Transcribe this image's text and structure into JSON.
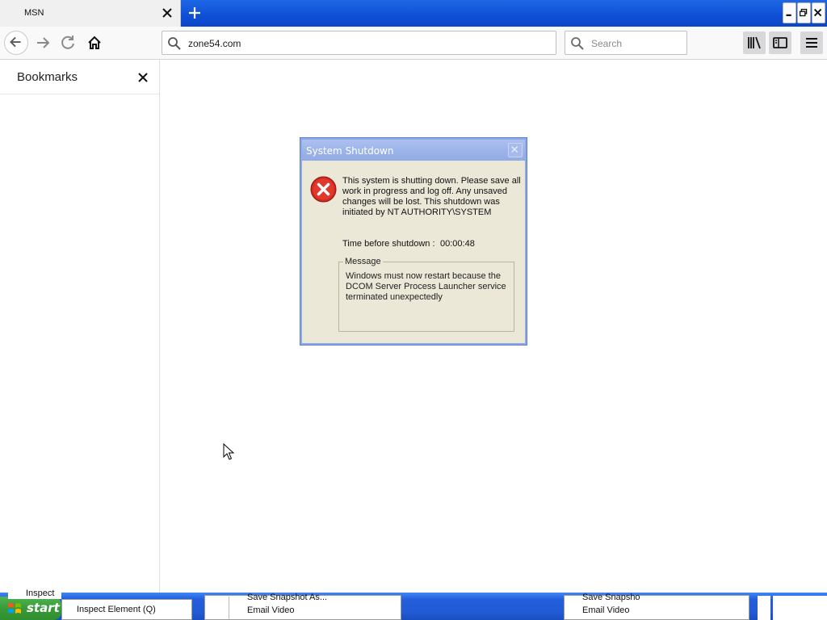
{
  "browser": {
    "tab_title": "MSN",
    "url": "zone54.com",
    "search_placeholder": "Search"
  },
  "sidebar": {
    "title": "Bookmarks"
  },
  "dialog": {
    "title": "System Shutdown",
    "message": "This system is shutting down. Please save all work in progress and log off. Any unsaved changes will be lost. This shutdown was initiated by NT AUTHORITY\\SYSTEM",
    "time_label": "Time before shutdown :",
    "time_value": "00:00:48",
    "group_label": "Message",
    "group_text": "Windows must now restart because the DCOM Server Process Launcher service terminated unexpectedly"
  },
  "taskbar": {
    "start_label": "start",
    "inspect_fragment": "Inspect",
    "inspect_menu_item": "Inspect Element (Q)",
    "save_snapshot_item": "Save Snapshot As...",
    "email_video_item": "Email Video",
    "save_snapshot_item_b": "Save Snapsho",
    "email_video_item_b": "Email Video"
  },
  "colors": {
    "taskbar_blue": "#245edb",
    "start_green": "#3a9a3a",
    "dialog_face": "#ebe8d8",
    "error_red": "#d42a20"
  },
  "icons": [
    "close-icon",
    "plus-icon",
    "back-arrow-icon",
    "forward-arrow-icon",
    "reload-icon",
    "home-icon",
    "search-icon",
    "library-icon",
    "sidebar-icon",
    "hamburger-menu-icon",
    "error-icon",
    "windows-logo-icon"
  ]
}
